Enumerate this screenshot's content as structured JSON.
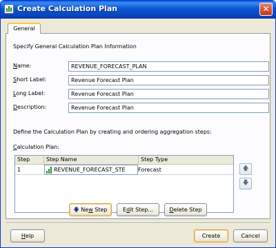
{
  "window": {
    "title": "Create Calculation Plan",
    "close_glyph": "✕"
  },
  "tabs": [
    {
      "label": "General"
    }
  ],
  "general": {
    "intro": "Specify General Calculation Plan Information",
    "fields": [
      {
        "label_key": "N",
        "label_rest": "ame:",
        "value": "REVENUE_FORECAST_PLAN"
      },
      {
        "label_key": "S",
        "label_rest": "hort Label:",
        "value": "Revenue Forecast Plan"
      },
      {
        "label_key": "L",
        "label_rest": "ong Label:",
        "value": "Revenue Forecast Plan"
      },
      {
        "label_key": "D",
        "label_rest": "escription:",
        "value": "Revenue Forecast Plan"
      }
    ],
    "define_text": "Define the Calculation Plan by creating and ordering aggregation steps:",
    "plan_label_key": "C",
    "plan_label_rest": "alculation Plan:"
  },
  "table": {
    "headers": [
      "Step",
      "Step Name",
      "Step Type"
    ],
    "rows": [
      {
        "step": "1",
        "name": "REVENUE_FORECAST_STE",
        "type": "Forecast",
        "icon": "bar-chart-icon"
      }
    ]
  },
  "side_buttons": {
    "up_glyph": "🡅",
    "down_glyph": "🡇",
    "up_icon": "move-up-icon",
    "down_icon": "move-down-icon"
  },
  "step_buttons": {
    "new_arrow": "🡇",
    "new_pre": "Ne",
    "new_key": "w",
    "new_post": " Step",
    "edit_pre": "E",
    "edit_key": "d",
    "edit_post": "it Step...",
    "delete_pre": "",
    "delete_key": "D",
    "delete_post": "elete Step"
  },
  "footer": {
    "help_key": "H",
    "help_rest": "elp",
    "create": "Create",
    "cancel": "Cancel"
  },
  "colors": {
    "titlebar": "#0a56d0",
    "dialog_bg": "#ece9d8",
    "tab_accent": "#ffc83c"
  }
}
